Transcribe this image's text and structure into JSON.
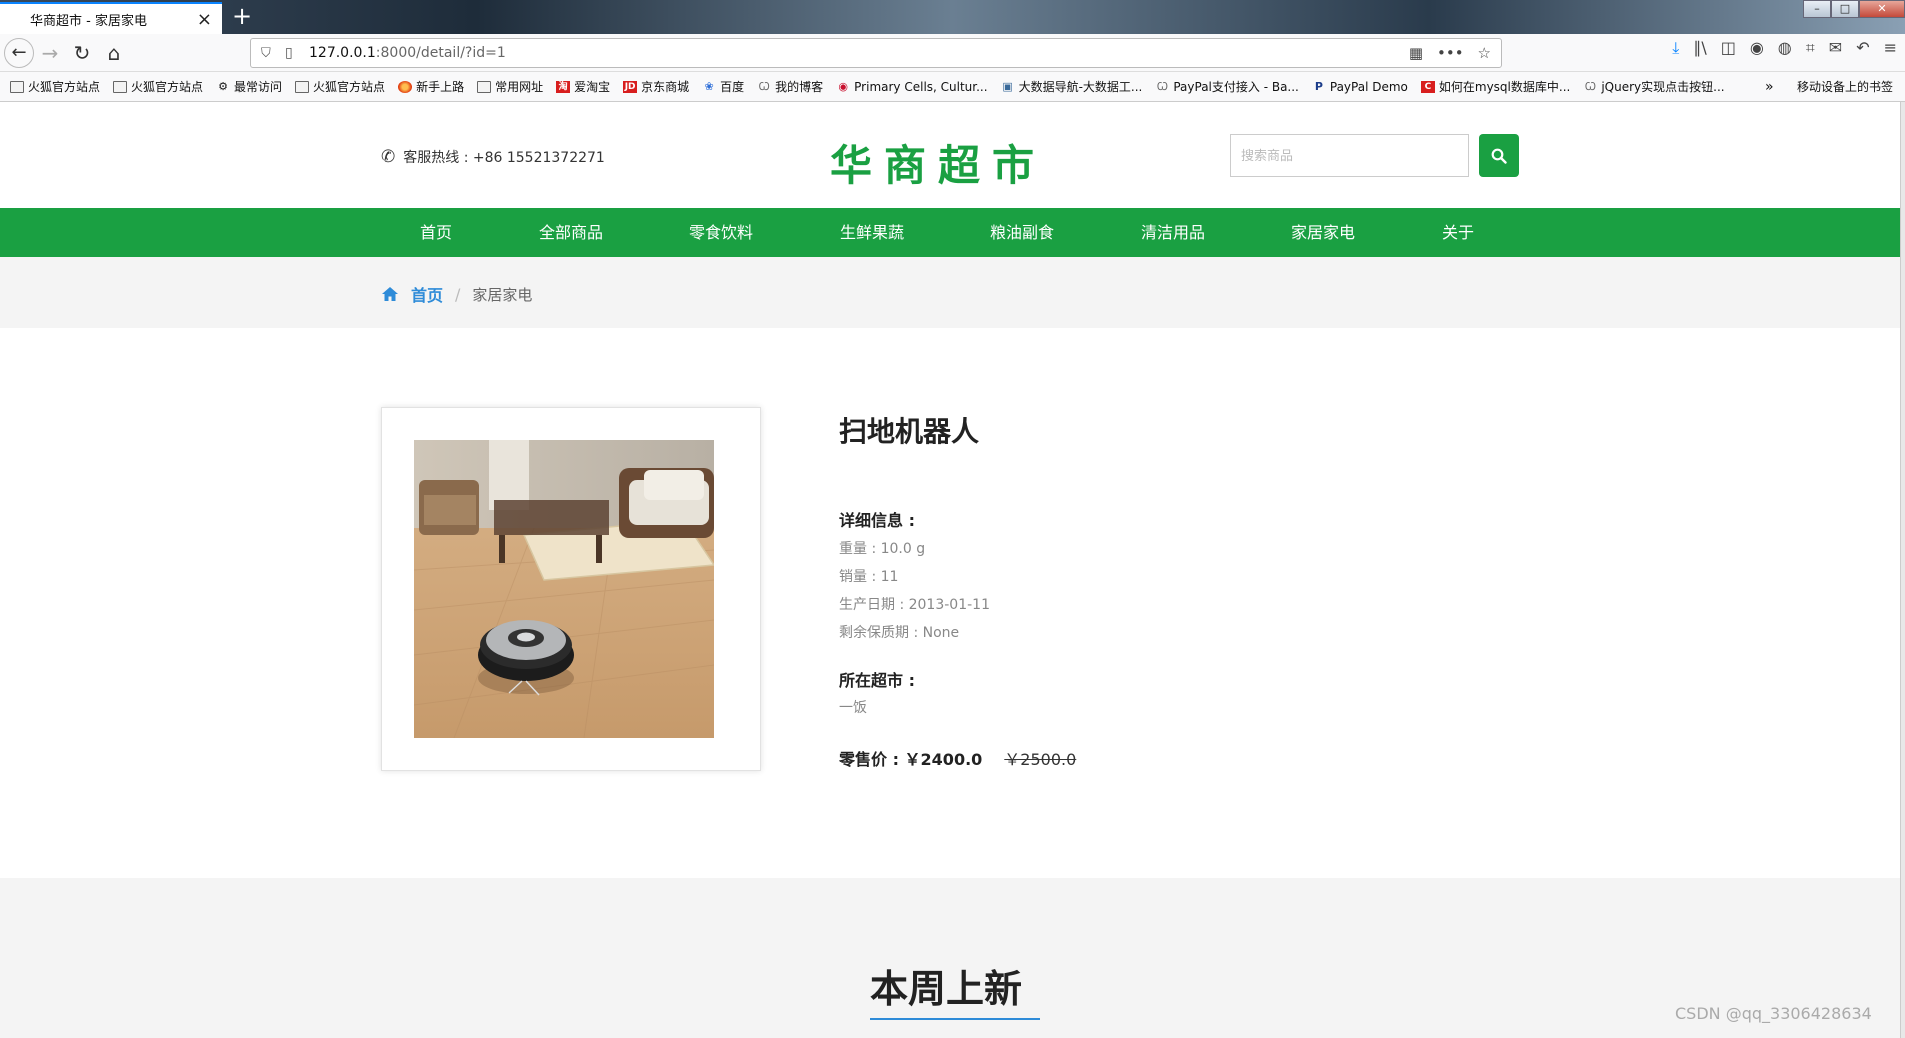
{
  "browser": {
    "tab_title": "华商超市 - 家居家电",
    "url_host": "127.0.0.1",
    "url_rest": ":8000/detail/?id=1",
    "bookmarks": [
      {
        "label": "火狐官方站点",
        "icon": "folder-icon"
      },
      {
        "label": "火狐官方站点",
        "icon": "folder-icon"
      },
      {
        "label": "最常访问",
        "icon": "gear-icon"
      },
      {
        "label": "火狐官方站点",
        "icon": "folder-icon"
      },
      {
        "label": "新手上路",
        "icon": "firefox-icon"
      },
      {
        "label": "常用网址",
        "icon": "folder-icon"
      },
      {
        "label": "爱淘宝",
        "icon": "taobao-icon"
      },
      {
        "label": "京东商城",
        "icon": "jd-icon"
      },
      {
        "label": "百度",
        "icon": "baidu-icon"
      },
      {
        "label": "我的博客",
        "icon": "blog-icon"
      },
      {
        "label": "Primary Cells, Cultur...",
        "icon": "site-icon"
      },
      {
        "label": "大数据导航-大数据工...",
        "icon": "site-icon"
      },
      {
        "label": "PayPal支付接入 - Ba...",
        "icon": "blog-icon"
      },
      {
        "label": "PayPal Demo",
        "icon": "paypal-icon"
      },
      {
        "label": "如何在mysql数据库中...",
        "icon": "csdn-icon"
      },
      {
        "label": "jQuery实现点击按钮...",
        "icon": "blog-icon"
      }
    ],
    "bookmarks_more": "»",
    "mobile_bookmarks": "移动设备上的书签"
  },
  "header": {
    "hotline": "客服热线 : +86 15521372271",
    "logo": "华商超市",
    "search_placeholder": "搜索商品"
  },
  "nav": {
    "items": [
      "首页",
      "全部商品",
      "零食饮料",
      "生鲜果蔬",
      "粮油副食",
      "清洁用品",
      "家居家电",
      "关于"
    ]
  },
  "breadcrumb": {
    "home": "首页",
    "separator": "/",
    "current": "家居家电"
  },
  "product": {
    "name": "扫地机器人",
    "details_label": "详细信息 :",
    "weight": "重量 : 10.0 g",
    "sales": "销量 : 11",
    "production_date": "生产日期 : 2013-01-11",
    "shelf_life": "剩余保质期 : None",
    "store_label": "所在超市 :",
    "store": "一饭",
    "price_label": "零售价 : ￥2400.0",
    "old_price": "￥2500.0"
  },
  "new_arrivals": {
    "title": "本周上新"
  },
  "watermark": "CSDN @qq_3306428634",
  "colors": {
    "brand_green": "#1aa042",
    "link_blue": "#2e8bd8",
    "nav_text": "#ffffff"
  }
}
